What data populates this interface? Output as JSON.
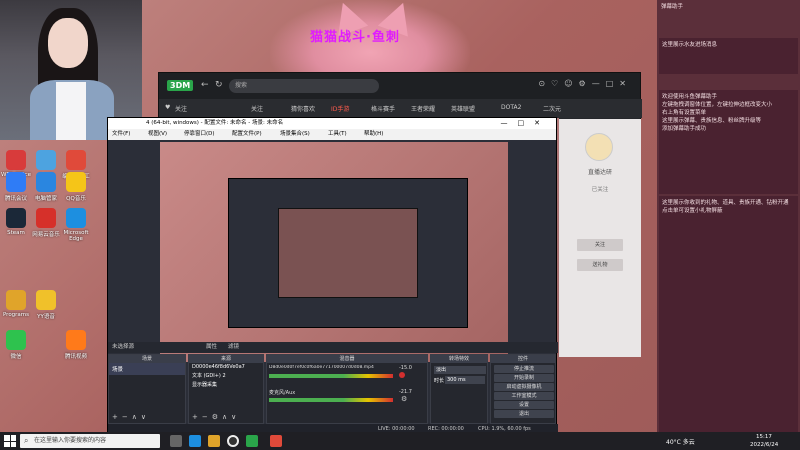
{
  "wallpaper": {
    "title": "猫猫战斗·鱼刺"
  },
  "desktop_icons": [
    {
      "label": "WPS Office",
      "color": "#d83b3b"
    },
    {
      "label": "此电脑",
      "color": "#4da3e0"
    },
    {
      "label": "编辑可能工具",
      "color": "#e04a3a"
    },
    {
      "label": "腾讯会议",
      "color": "#2f7cf6"
    },
    {
      "label": "电脑管家",
      "color": "#2a86e0"
    },
    {
      "label": "QQ音乐",
      "color": "#f5c518"
    },
    {
      "label": "Steam",
      "color": "#1b2838"
    },
    {
      "label": "网易云音乐",
      "color": "#d6302a"
    },
    {
      "label": "Microsoft Edge",
      "color": "#1d8fe0"
    },
    {
      "label": "Programs",
      "color": "#e0a42a"
    },
    {
      "label": "YY语音",
      "color": "#f0c12a"
    },
    {
      "label": "微信",
      "color": "#2ec24e"
    },
    {
      "label": "腾讯视频",
      "color": "#ff7a1a"
    }
  ],
  "app3d": {
    "logo": "3DM",
    "search_placeholder": "搜索",
    "follow_label": "关注",
    "tabs": [
      "关注",
      "猜你喜欢",
      "ID手游",
      "格斗赛手",
      "王者荣耀",
      "英雄联盟",
      "DOTA2",
      "二次元"
    ],
    "active_tab": "ID手游",
    "streamer_name": "直播达研",
    "fans": "已关注",
    "follow_btn": "关注",
    "gift_btn": "送礼物"
  },
  "obs": {
    "title": "4 (64-bit, windows) - 配置文件: 未命名 - 场景: 未命名",
    "menus": [
      "文件(F)",
      "视图(V)",
      "停靠窗口(D)",
      "配置文件(P)",
      "场景集合(S)",
      "工具(T)",
      "帮助(H)"
    ],
    "status_bar_left": "未选择源",
    "status_props": "属性",
    "status_filter": "滤镜",
    "docks": {
      "scenes": {
        "title": "场景",
        "items": [
          "场景"
        ]
      },
      "sources": {
        "title": "来源",
        "items": [
          "D0000e46f8d6Ve0a7",
          "文本 (GDI+) 2",
          "显示器采集"
        ]
      },
      "mixer": {
        "title": "混音器",
        "track1": "D8d0e0d0f7ef0c0f6a0e771700007d0d08.mp4",
        "track1_db": "-15.0",
        "track2": "麦克风/Aux",
        "track2_db": "-21.7"
      },
      "transitions": {
        "title": "转场特效",
        "mode": "淡出",
        "duration_label": "时长",
        "duration": "300 ms"
      },
      "controls": {
        "title": "控件",
        "buttons": [
          "停止推流",
          "开始录制",
          "启动虚拟摄像机",
          "工作室模式",
          "设置",
          "退出"
        ]
      }
    },
    "statusbar": {
      "live": "LIVE: 00:00:00",
      "rec": "REC: 00:00:00",
      "cpu": "CPU: 1.9%, 60.00 fps"
    }
  },
  "chat": {
    "header": "弹幕助手",
    "welcome_title": "这里展示水友进场消息",
    "messages": [
      "欢迎使用斗鱼弹幕助手",
      "左键拖拽调窗体位置，左键拉伸边框改变大小",
      "右上角有设置菜单",
      "这里展示弹幕、贵族信息、粉丝牌升级等",
      "添加弹幕助手成功"
    ],
    "gift_note": "这里展示你收到的礼物、道具、贵族开通、钻粉开通",
    "gift_note2": "点击单可设置小礼物屏蔽"
  },
  "taskbar": {
    "search_placeholder": "在这里输入你要搜索的内容",
    "weather": "40°C 多云",
    "time": "15:17",
    "date": "2022/6/24"
  }
}
